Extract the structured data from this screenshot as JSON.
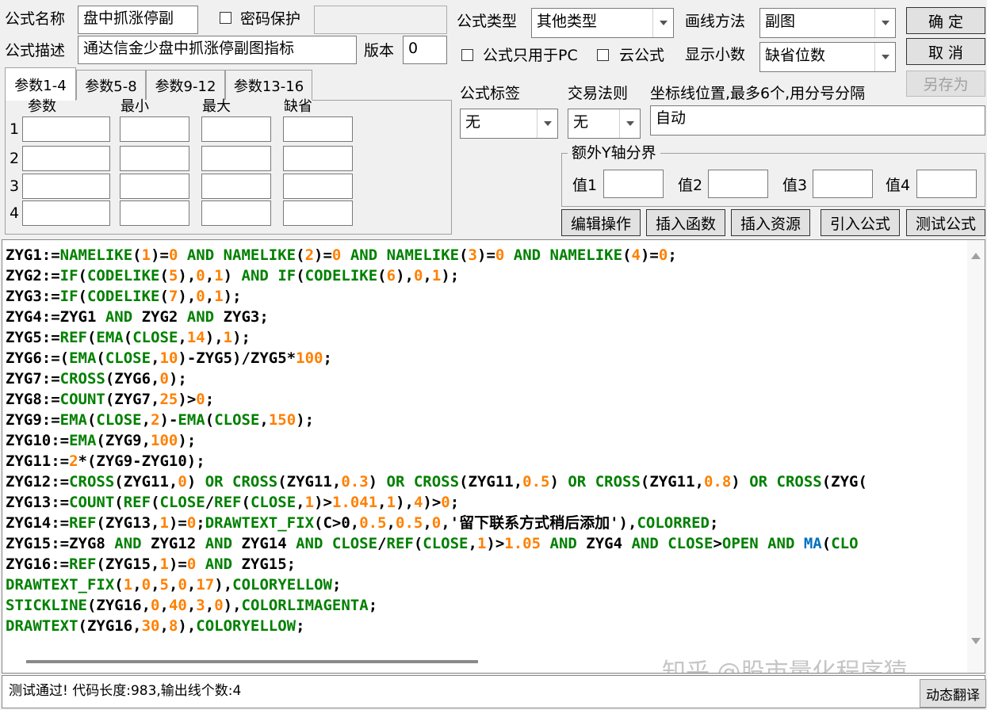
{
  "formula": {
    "name_label": "公式名称",
    "name_value": "盘中抓涨停副",
    "password_label": "密码保护",
    "password_value": "",
    "desc_label": "公式描述",
    "desc_value": "通达信金少盘中抓涨停副图指标",
    "version_label": "版本",
    "version_value": "0"
  },
  "settings": {
    "type_label": "公式类型",
    "type_value": "其他类型",
    "draw_label": "画线方法",
    "draw_value": "副图",
    "pc_only_label": "公式只用于PC",
    "cloud_label": "云公式",
    "decimal_label": "显示小数",
    "decimal_value": "缺省位数",
    "tag_label": "公式标签",
    "tag_value": "无",
    "rule_label": "交易法则",
    "rule_value": "无",
    "axis_label": "坐标线位置,最多6个,用分号分隔",
    "axis_value": "自动",
    "yaxis_group_label": "额外Y轴分界",
    "val1_label": "值1",
    "val2_label": "值2",
    "val3_label": "值3",
    "val4_label": "值4"
  },
  "buttons": {
    "ok": "确 定",
    "cancel": "取 消",
    "save_as": "另存为",
    "edit_ops": "编辑操作",
    "insert_func": "插入函数",
    "insert_res": "插入资源",
    "import_formula": "引入公式",
    "test_formula": "测试公式",
    "translate": "动态翻译"
  },
  "params": {
    "tabs": [
      "参数1-4",
      "参数5-8",
      "参数9-12",
      "参数13-16"
    ],
    "headers": [
      "参数",
      "最小",
      "最大",
      "缺省"
    ],
    "row_numbers": [
      "1",
      "2",
      "3",
      "4"
    ]
  },
  "code_lines": [
    [
      [
        "ZYG1:=",
        "k"
      ],
      [
        "NAMELIKE",
        "g"
      ],
      [
        "(",
        "k"
      ],
      [
        "1",
        "o"
      ],
      [
        ")=",
        "k"
      ],
      [
        "0",
        "o"
      ],
      [
        " AND ",
        "g"
      ],
      [
        "NAMELIKE",
        "g"
      ],
      [
        "(",
        "k"
      ],
      [
        "2",
        "o"
      ],
      [
        ")=",
        "k"
      ],
      [
        "0",
        "o"
      ],
      [
        " AND ",
        "g"
      ],
      [
        "NAMELIKE",
        "g"
      ],
      [
        "(",
        "k"
      ],
      [
        "3",
        "o"
      ],
      [
        ")=",
        "k"
      ],
      [
        "0",
        "o"
      ],
      [
        " AND ",
        "g"
      ],
      [
        "NAMELIKE",
        "g"
      ],
      [
        "(",
        "k"
      ],
      [
        "4",
        "o"
      ],
      [
        ")=",
        "k"
      ],
      [
        "0",
        "o"
      ],
      [
        ";",
        "k"
      ]
    ],
    [
      [
        "ZYG2:=",
        "k"
      ],
      [
        "IF",
        "g"
      ],
      [
        "(",
        "k"
      ],
      [
        "CODELIKE",
        "g"
      ],
      [
        "(",
        "k"
      ],
      [
        "5",
        "o"
      ],
      [
        "),",
        "k"
      ],
      [
        "0",
        "o"
      ],
      [
        ",",
        "k"
      ],
      [
        "1",
        "o"
      ],
      [
        ")",
        "k"
      ],
      [
        " AND ",
        "g"
      ],
      [
        "IF",
        "g"
      ],
      [
        "(",
        "k"
      ],
      [
        "CODELIKE",
        "g"
      ],
      [
        "(",
        "k"
      ],
      [
        "6",
        "o"
      ],
      [
        "),",
        "k"
      ],
      [
        "0",
        "o"
      ],
      [
        ",",
        "k"
      ],
      [
        "1",
        "o"
      ],
      [
        ");",
        "k"
      ]
    ],
    [
      [
        "ZYG3:=",
        "k"
      ],
      [
        "IF",
        "g"
      ],
      [
        "(",
        "k"
      ],
      [
        "CODELIKE",
        "g"
      ],
      [
        "(",
        "k"
      ],
      [
        "7",
        "o"
      ],
      [
        "),",
        "k"
      ],
      [
        "0",
        "o"
      ],
      [
        ",",
        "k"
      ],
      [
        "1",
        "o"
      ],
      [
        ");",
        "k"
      ]
    ],
    [
      [
        "ZYG4:=ZYG1",
        "k"
      ],
      [
        " AND ",
        "g"
      ],
      [
        "ZYG2",
        "k"
      ],
      [
        " AND ",
        "g"
      ],
      [
        "ZYG3;",
        "k"
      ]
    ],
    [
      [
        "ZYG5:=",
        "k"
      ],
      [
        "REF",
        "g"
      ],
      [
        "(",
        "k"
      ],
      [
        "EMA",
        "g"
      ],
      [
        "(",
        "k"
      ],
      [
        "CLOSE",
        "g"
      ],
      [
        ",",
        "k"
      ],
      [
        "14",
        "o"
      ],
      [
        "),",
        "k"
      ],
      [
        "1",
        "o"
      ],
      [
        ");",
        "k"
      ]
    ],
    [
      [
        "ZYG6:=(",
        "k"
      ],
      [
        "EMA",
        "g"
      ],
      [
        "(",
        "k"
      ],
      [
        "CLOSE",
        "g"
      ],
      [
        ",",
        "k"
      ],
      [
        "10",
        "o"
      ],
      [
        ")-ZYG5)/ZYG5*",
        "k"
      ],
      [
        "100",
        "o"
      ],
      [
        ";",
        "k"
      ]
    ],
    [
      [
        "ZYG7:=",
        "k"
      ],
      [
        "CROSS",
        "g"
      ],
      [
        "(ZYG6,",
        "k"
      ],
      [
        "0",
        "o"
      ],
      [
        ");",
        "k"
      ]
    ],
    [
      [
        "ZYG8:=",
        "k"
      ],
      [
        "COUNT",
        "g"
      ],
      [
        "(ZYG7,",
        "k"
      ],
      [
        "25",
        "o"
      ],
      [
        ")>",
        "k"
      ],
      [
        "0",
        "o"
      ],
      [
        ";",
        "k"
      ]
    ],
    [
      [
        "ZYG9:=",
        "k"
      ],
      [
        "EMA",
        "g"
      ],
      [
        "(",
        "k"
      ],
      [
        "CLOSE",
        "g"
      ],
      [
        ",",
        "k"
      ],
      [
        "2",
        "o"
      ],
      [
        ")-",
        "k"
      ],
      [
        "EMA",
        "g"
      ],
      [
        "(",
        "k"
      ],
      [
        "CLOSE",
        "g"
      ],
      [
        ",",
        "k"
      ],
      [
        "150",
        "o"
      ],
      [
        ");",
        "k"
      ]
    ],
    [
      [
        "ZYG10:=",
        "k"
      ],
      [
        "EMA",
        "g"
      ],
      [
        "(ZYG9,",
        "k"
      ],
      [
        "100",
        "o"
      ],
      [
        ");",
        "k"
      ]
    ],
    [
      [
        "ZYG11:=",
        "k"
      ],
      [
        "2",
        "o"
      ],
      [
        "*(ZYG9-ZYG10);",
        "k"
      ]
    ],
    [
      [
        "ZYG12:=",
        "k"
      ],
      [
        "CROSS",
        "g"
      ],
      [
        "(ZYG11,",
        "k"
      ],
      [
        "0",
        "o"
      ],
      [
        ")",
        "k"
      ],
      [
        " OR ",
        "g"
      ],
      [
        "CROSS",
        "g"
      ],
      [
        "(ZYG11,",
        "k"
      ],
      [
        "0.3",
        "o"
      ],
      [
        ")",
        "k"
      ],
      [
        " OR ",
        "g"
      ],
      [
        "CROSS",
        "g"
      ],
      [
        "(ZYG11,",
        "k"
      ],
      [
        "0.5",
        "o"
      ],
      [
        ")",
        "k"
      ],
      [
        " OR ",
        "g"
      ],
      [
        "CROSS",
        "g"
      ],
      [
        "(ZYG11,",
        "k"
      ],
      [
        "0.8",
        "o"
      ],
      [
        ")",
        "k"
      ],
      [
        " OR ",
        "g"
      ],
      [
        "CROSS",
        "g"
      ],
      [
        "(ZYG(",
        "k"
      ]
    ],
    [
      [
        "ZYG13:=",
        "k"
      ],
      [
        "COUNT",
        "g"
      ],
      [
        "(",
        "k"
      ],
      [
        "REF",
        "g"
      ],
      [
        "(",
        "k"
      ],
      [
        "CLOSE",
        "g"
      ],
      [
        "/",
        "k"
      ],
      [
        "REF",
        "g"
      ],
      [
        "(",
        "k"
      ],
      [
        "CLOSE",
        "g"
      ],
      [
        ",",
        "k"
      ],
      [
        "1",
        "o"
      ],
      [
        ")>",
        "k"
      ],
      [
        "1.041",
        "o"
      ],
      [
        ",",
        "k"
      ],
      [
        "1",
        "o"
      ],
      [
        "),",
        "k"
      ],
      [
        "4",
        "o"
      ],
      [
        ")>",
        "k"
      ],
      [
        "0",
        "o"
      ],
      [
        ";",
        "k"
      ]
    ],
    [
      [
        "ZYG14:=",
        "k"
      ],
      [
        "REF",
        "g"
      ],
      [
        "(ZYG13,",
        "k"
      ],
      [
        "1",
        "o"
      ],
      [
        ")=",
        "k"
      ],
      [
        "0",
        "o"
      ],
      [
        ";",
        "k"
      ],
      [
        "DRAWTEXT_FIX",
        "g"
      ],
      [
        "(C>0,",
        "k"
      ],
      [
        "0.5",
        "o"
      ],
      [
        ",",
        "k"
      ],
      [
        "0.5",
        "o"
      ],
      [
        ",",
        "k"
      ],
      [
        "0",
        "o"
      ],
      [
        ",'留下联系方式稍后添加'),",
        "k"
      ],
      [
        "COLORRED",
        "g"
      ],
      [
        ";",
        "k"
      ]
    ],
    [
      [
        "ZYG15:=ZYG8",
        "k"
      ],
      [
        " AND ",
        "g"
      ],
      [
        "ZYG12",
        "k"
      ],
      [
        " AND ",
        "g"
      ],
      [
        "ZYG14",
        "k"
      ],
      [
        " AND ",
        "g"
      ],
      [
        "CLOSE",
        "g"
      ],
      [
        "/",
        "k"
      ],
      [
        "REF",
        "g"
      ],
      [
        "(",
        "k"
      ],
      [
        "CLOSE",
        "g"
      ],
      [
        ",",
        "k"
      ],
      [
        "1",
        "o"
      ],
      [
        ")>",
        "k"
      ],
      [
        "1.05",
        "o"
      ],
      [
        " AND ",
        "g"
      ],
      [
        "ZYG4",
        "k"
      ],
      [
        " AND ",
        "g"
      ],
      [
        "CLOSE",
        "g"
      ],
      [
        ">",
        "k"
      ],
      [
        "OPEN",
        "g"
      ],
      [
        " AND ",
        "g"
      ],
      [
        "MA",
        "b"
      ],
      [
        "(",
        "k"
      ],
      [
        "CLO",
        "g"
      ]
    ],
    [
      [
        "ZYG16:=",
        "k"
      ],
      [
        "REF",
        "g"
      ],
      [
        "(ZYG15,",
        "k"
      ],
      [
        "1",
        "o"
      ],
      [
        ")=",
        "k"
      ],
      [
        "0",
        "o"
      ],
      [
        " AND ",
        "g"
      ],
      [
        "ZYG15;",
        "k"
      ]
    ],
    [
      [
        "DRAWTEXT_FIX",
        "g"
      ],
      [
        "(",
        "k"
      ],
      [
        "1",
        "o"
      ],
      [
        ",",
        "k"
      ],
      [
        "0",
        "o"
      ],
      [
        ",",
        "k"
      ],
      [
        "5",
        "o"
      ],
      [
        ",",
        "k"
      ],
      [
        "0",
        "o"
      ],
      [
        ",",
        "k"
      ],
      [
        "17",
        "o"
      ],
      [
        "),",
        "k"
      ],
      [
        "COLORYELLOW",
        "g"
      ],
      [
        ";",
        "k"
      ]
    ],
    [
      [
        "STICKLINE",
        "g"
      ],
      [
        "(ZYG16,",
        "k"
      ],
      [
        "0",
        "o"
      ],
      [
        ",",
        "k"
      ],
      [
        "40",
        "o"
      ],
      [
        ",",
        "k"
      ],
      [
        "3",
        "o"
      ],
      [
        ",",
        "k"
      ],
      [
        "0",
        "o"
      ],
      [
        "),",
        "k"
      ],
      [
        "COLORLIMAGENTA",
        "g"
      ],
      [
        ";",
        "k"
      ]
    ],
    [
      [
        "DRAWTEXT",
        "g"
      ],
      [
        "(ZYG16,",
        "k"
      ],
      [
        "30",
        "o"
      ],
      [
        ",",
        "k"
      ],
      [
        "8",
        "o"
      ],
      [
        "),",
        "k"
      ],
      [
        "COLORYELLOW",
        "g"
      ],
      [
        ";",
        "k"
      ]
    ]
  ],
  "code_colors": {
    "k": "#000000",
    "g": "#008000",
    "o": "#ff8000",
    "b": "#0070c0"
  },
  "status_text": "测试通过! 代码长度:983,输出线个数:4",
  "watermark": "知乎 @股市量化程序猿"
}
